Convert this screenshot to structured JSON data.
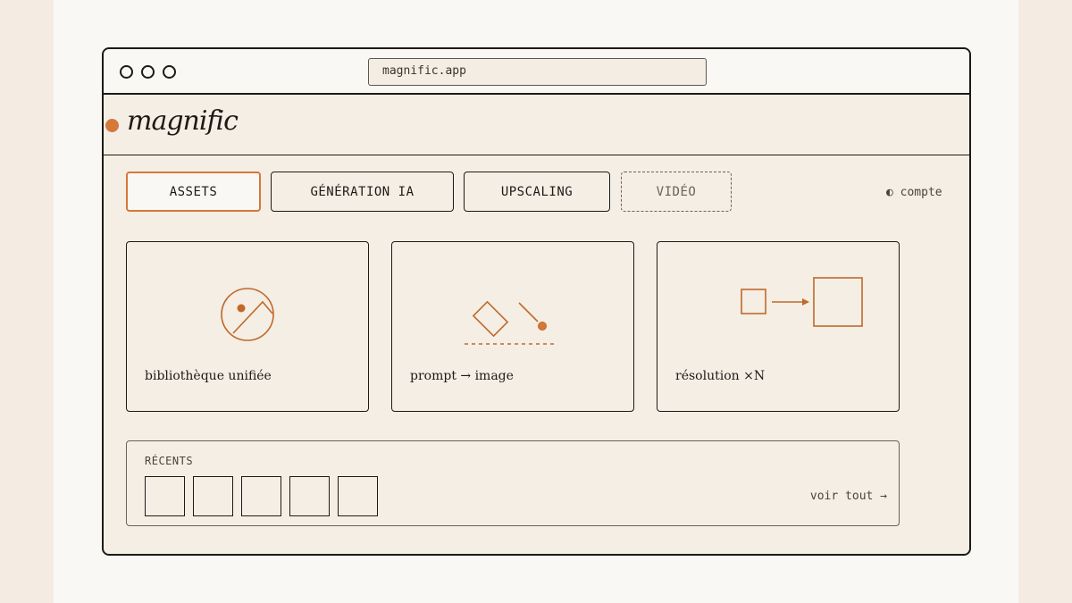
{
  "browser": {
    "url": "magnific.app"
  },
  "app": {
    "brand": "magnific",
    "accent_color": "#d4793a"
  },
  "tabs": [
    {
      "label": "ASSETS",
      "state": "active"
    },
    {
      "label": "GÉNÉRATION IA",
      "state": "normal"
    },
    {
      "label": "UPSCALING",
      "state": "normal"
    },
    {
      "label": "VIDÉO",
      "state": "dashed"
    }
  ],
  "account": {
    "icon": "half-circle-icon",
    "label": "◐ compte"
  },
  "cards": [
    {
      "icon": "image-icon",
      "label": "bibliothèque unifiée"
    },
    {
      "icon": "prompt-to-image-icon",
      "label": "prompt → image"
    },
    {
      "icon": "upscale-arrow-icon",
      "label": "résolution ×N"
    }
  ],
  "recents": {
    "title": "RÉCENTS",
    "thumbnail_count": 5,
    "see_all": "voir tout →"
  }
}
